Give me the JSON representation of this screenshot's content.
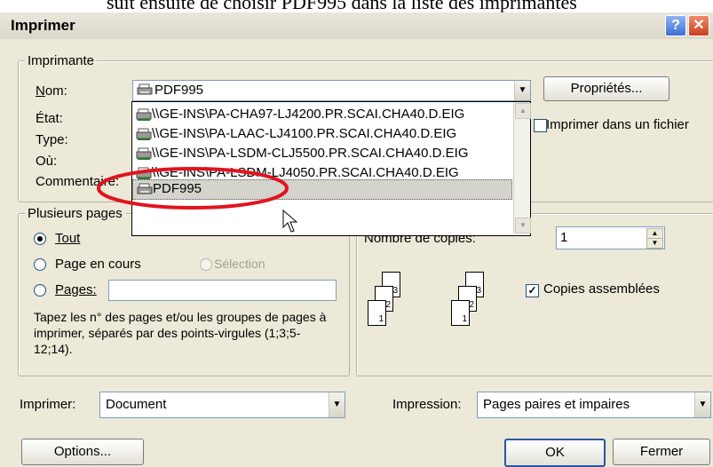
{
  "caption_fragment": "suit ensuite de choisir PDF995 dans la liste des imprimantes",
  "window": {
    "title": "Imprimer",
    "help_glyph": "?",
    "close_glyph": "✕"
  },
  "printer_group": {
    "legend": "Imprimante",
    "name_label": "Nom:",
    "selected_printer": "PDF995",
    "properties_button": "Propriétés...",
    "print_to_file_label": "Imprimer dans un fichier",
    "state_label": "État:",
    "type_label": "Type:",
    "where_label": "Où:",
    "comment_label": "Commentaire:",
    "dropdown_items": [
      "\\\\GE-INS\\PA-CHA97-LJ4200.PR.SCAI.CHA40.D.EIG",
      "\\\\GE-INS\\PA-LAAC-LJ4100.PR.SCAI.CHA40.D.EIG",
      "\\\\GE-INS\\PA-LSDM-CLJ5500.PR.SCAI.CHA40.D.EIG",
      "\\\\GE-INS\\PA-LSDM-LJ4050.PR.SCAI.CHA40.D.EIG",
      "PDF995"
    ],
    "highlighted_index": 4
  },
  "pages_group": {
    "legend": "Plusieurs pages",
    "all_label": "Tout",
    "current_page_label": "Page en cours",
    "selection_label": "Sélection",
    "pages_label": "Pages:",
    "pages_value": "",
    "help_text": "Tapez les n° des pages et/ou les groupes de pages à imprimer, séparés par des points-virgules (1;3;5-12;14)."
  },
  "copies_group": {
    "copies_label": "Nombre de copies:",
    "copies_value": "1",
    "collate_label": "Copies assemblées",
    "collate_checked": true,
    "sheet_numbers": [
      "3",
      "2",
      "1"
    ]
  },
  "print_what": {
    "label": "Imprimer:",
    "value": "Document"
  },
  "print_range": {
    "label": "Impression:",
    "value": "Pages paires et impaires"
  },
  "buttons": {
    "options": "Options...",
    "ok": "OK",
    "close": "Fermer"
  },
  "colors": {
    "highlight_ring": "#e0141e",
    "xp_title_blue": "#3d6fd8",
    "dialog_bg": "#ece9d8"
  }
}
